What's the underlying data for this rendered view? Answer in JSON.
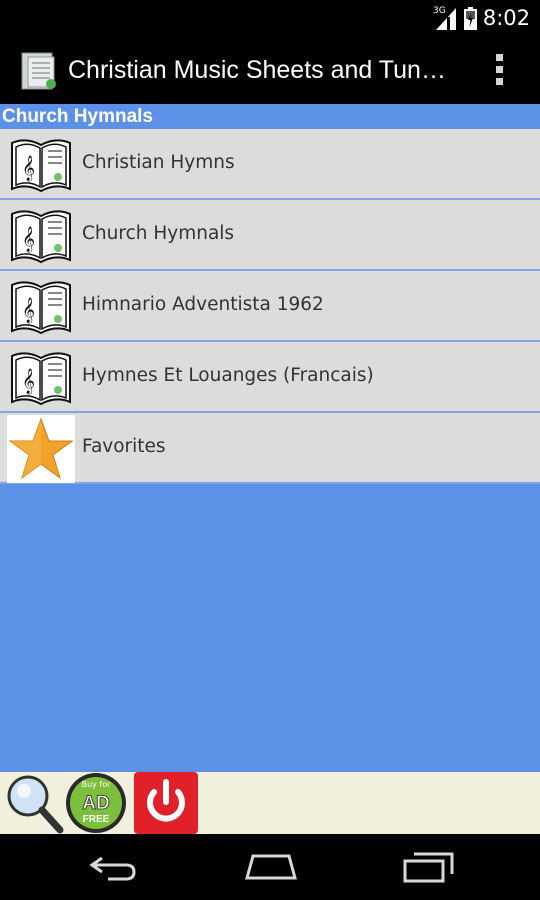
{
  "status_bar": {
    "network": "3G",
    "time": "8:02"
  },
  "action_bar": {
    "title": "Christian Music Sheets and Tun…"
  },
  "section": {
    "header": "Church Hymnals"
  },
  "list": {
    "items": [
      {
        "label": "Christian Hymns",
        "icon": "hymnal-book-icon"
      },
      {
        "label": "Church Hymnals",
        "icon": "hymnal-book-icon"
      },
      {
        "label": "Himnario Adventista 1962",
        "icon": "hymnal-book-icon"
      },
      {
        "label": "Hymnes Et Louanges (Francais)",
        "icon": "hymnal-book-icon"
      },
      {
        "label": "Favorites",
        "icon": "star-icon"
      }
    ]
  },
  "toolbar": {
    "ad_free": {
      "top": "Buy for",
      "main": "AD",
      "bottom": "FREE"
    }
  },
  "colors": {
    "accent_blue": "#5d91e8",
    "list_item_bg": "#dcdcdc",
    "toolbar_bg": "#f1f0dc",
    "star": "#f2a22a",
    "power_red": "#e0212a"
  }
}
